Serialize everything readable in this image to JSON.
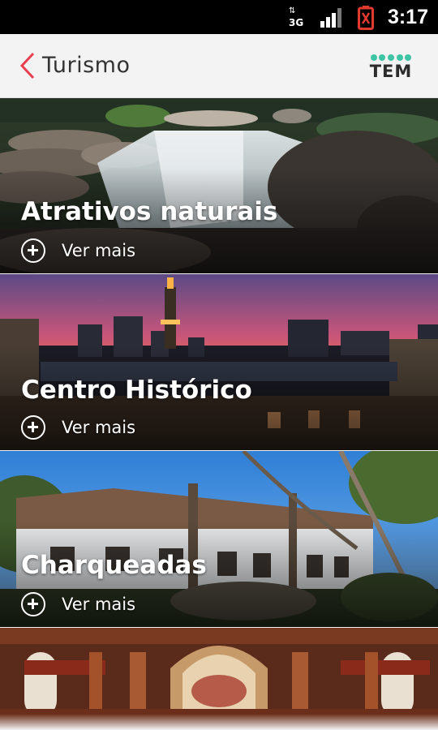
{
  "status_bar": {
    "time": "3:17",
    "network_type": "3G",
    "network_arrows": "⇅",
    "icons": [
      "network-3g-icon",
      "signal-strength-icon",
      "battery-low-icon"
    ]
  },
  "app_bar": {
    "title": "Turismo",
    "back_icon": "chevron-left-icon",
    "logo_text": "TEM",
    "accent_color": "#e8404f",
    "logo_dot_color": "#3cc4a4"
  },
  "cards": [
    {
      "title": "Atrativos naturais",
      "action_label": "Ver mais",
      "image": "waterfall-photo"
    },
    {
      "title": "Centro Histórico",
      "action_label": "Ver mais",
      "image": "city-sunset-photo"
    },
    {
      "title": "Charqueadas",
      "action_label": "Ver mais",
      "image": "colonial-house-photo"
    },
    {
      "title": "",
      "action_label": "",
      "image": "church-interior-photo"
    }
  ]
}
